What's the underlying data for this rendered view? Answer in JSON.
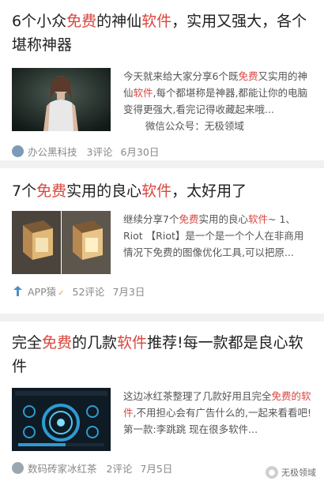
{
  "articles": [
    {
      "title_parts": [
        "6个小众",
        "免费",
        "的神仙",
        "软件",
        "，实用又强大，各个堪称神器"
      ],
      "summary_parts": [
        "今天就来给大家分享6个既",
        "免费",
        "又实用的神仙",
        "软件",
        ",每个都堪称是神器,都能让你的电脑变得更强大,看完记得收藏起来哦...",
        "       微信公众号：无极领域"
      ],
      "source": "办公黑科技",
      "comments": "3评论",
      "date": "6月30日",
      "source_icon": "office-tech-avatar-icon",
      "thumb_icon": "portrait-photo-thumbnail"
    },
    {
      "title_parts": [
        "7个",
        "免费",
        "实用的良心",
        "软件",
        "，太好用了"
      ],
      "summary_parts": [
        "继续分享7个",
        "免费",
        "实用的良心",
        "软件",
        "~ 1、Riot 【Riot】是一个是一个个人在非商用情况下免费的图像优化工具,可以把原..."
      ],
      "source": "APP猿",
      "source_badge": "✓",
      "comments": "52评论",
      "date": "7月3日",
      "source_icon": "app-ape-logo-icon",
      "thumb_icon": "lantern-compare-thumbnail"
    },
    {
      "title_parts": [
        "完全",
        "免费",
        "的几款",
        "软件",
        "推荐!每一款都是良心软件"
      ],
      "summary_parts": [
        "这边冰红茶整理了几款好用且完全",
        "免费",
        "的",
        "软件",
        ",不用担心会有广告什么的,一起来看看吧! 第一款:李跳跳 现在很多软件..."
      ],
      "source": "数码砖家冰红茶",
      "comments": "2评论",
      "date": "7月5日",
      "source_icon": "digital-expert-avatar-icon",
      "thumb_icon": "dashboard-ui-thumbnail"
    }
  ],
  "watermark": "无极领域",
  "colors": {
    "highlight": "#d9463e",
    "meta": "#888888",
    "divider": "#f1f1f1"
  }
}
